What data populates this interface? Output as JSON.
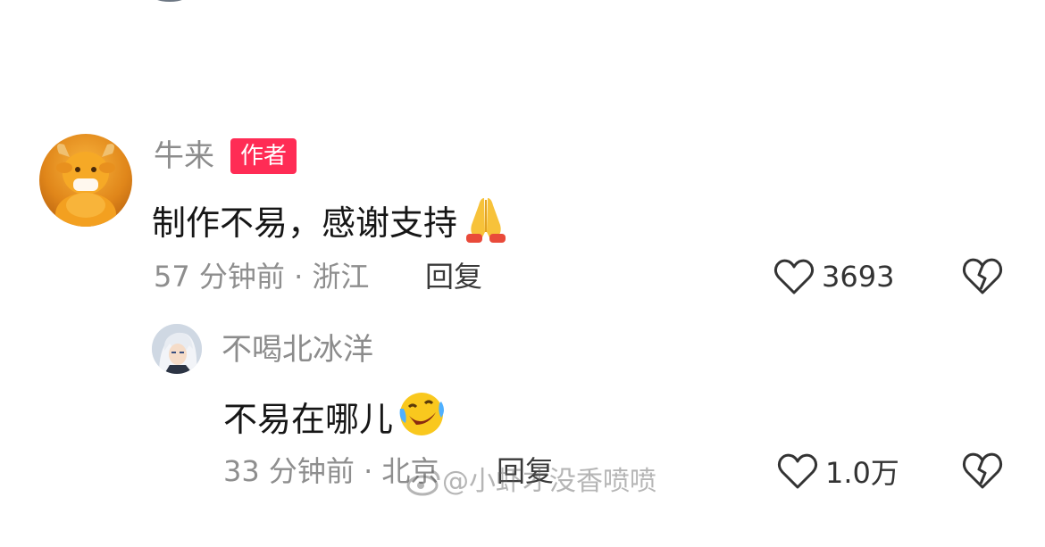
{
  "comment": {
    "username": "牛来",
    "badge": "作者",
    "text": "制作不易，感谢支持",
    "emoji": "pray-emoji",
    "meta": "57 分钟前 · 浙江",
    "reply_label": "回复",
    "like_count": "3693"
  },
  "reply": {
    "username": "不喝北冰洋",
    "text": "不易在哪儿",
    "emoji": "laughing-tears-emoji",
    "meta": "33 分钟前 · 北京",
    "reply_label": "回复",
    "like_count": "1.0万"
  },
  "watermark": {
    "text": "@小虾才没香喷喷"
  },
  "colors": {
    "badge": "#ff2c55",
    "username": "#8c8c8c",
    "text": "#161616",
    "meta": "#8e8e8e"
  }
}
